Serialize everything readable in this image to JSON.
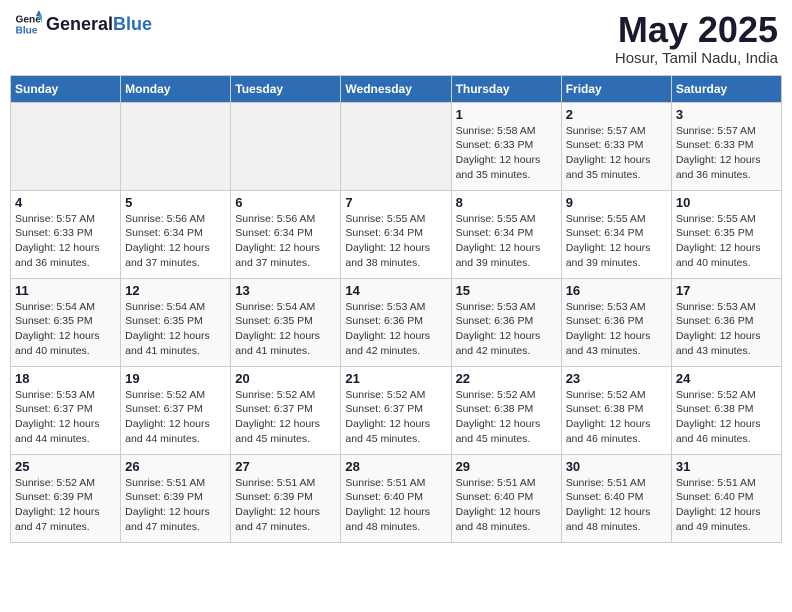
{
  "header": {
    "logo_general": "General",
    "logo_blue": "Blue",
    "title": "May 2025",
    "location": "Hosur, Tamil Nadu, India"
  },
  "days_of_week": [
    "Sunday",
    "Monday",
    "Tuesday",
    "Wednesday",
    "Thursday",
    "Friday",
    "Saturday"
  ],
  "weeks": [
    [
      {
        "day": "",
        "info": ""
      },
      {
        "day": "",
        "info": ""
      },
      {
        "day": "",
        "info": ""
      },
      {
        "day": "",
        "info": ""
      },
      {
        "day": "1",
        "info": "Sunrise: 5:58 AM\nSunset: 6:33 PM\nDaylight: 12 hours\nand 35 minutes."
      },
      {
        "day": "2",
        "info": "Sunrise: 5:57 AM\nSunset: 6:33 PM\nDaylight: 12 hours\nand 35 minutes."
      },
      {
        "day": "3",
        "info": "Sunrise: 5:57 AM\nSunset: 6:33 PM\nDaylight: 12 hours\nand 36 minutes."
      }
    ],
    [
      {
        "day": "4",
        "info": "Sunrise: 5:57 AM\nSunset: 6:33 PM\nDaylight: 12 hours\nand 36 minutes."
      },
      {
        "day": "5",
        "info": "Sunrise: 5:56 AM\nSunset: 6:34 PM\nDaylight: 12 hours\nand 37 minutes."
      },
      {
        "day": "6",
        "info": "Sunrise: 5:56 AM\nSunset: 6:34 PM\nDaylight: 12 hours\nand 37 minutes."
      },
      {
        "day": "7",
        "info": "Sunrise: 5:55 AM\nSunset: 6:34 PM\nDaylight: 12 hours\nand 38 minutes."
      },
      {
        "day": "8",
        "info": "Sunrise: 5:55 AM\nSunset: 6:34 PM\nDaylight: 12 hours\nand 39 minutes."
      },
      {
        "day": "9",
        "info": "Sunrise: 5:55 AM\nSunset: 6:34 PM\nDaylight: 12 hours\nand 39 minutes."
      },
      {
        "day": "10",
        "info": "Sunrise: 5:55 AM\nSunset: 6:35 PM\nDaylight: 12 hours\nand 40 minutes."
      }
    ],
    [
      {
        "day": "11",
        "info": "Sunrise: 5:54 AM\nSunset: 6:35 PM\nDaylight: 12 hours\nand 40 minutes."
      },
      {
        "day": "12",
        "info": "Sunrise: 5:54 AM\nSunset: 6:35 PM\nDaylight: 12 hours\nand 41 minutes."
      },
      {
        "day": "13",
        "info": "Sunrise: 5:54 AM\nSunset: 6:35 PM\nDaylight: 12 hours\nand 41 minutes."
      },
      {
        "day": "14",
        "info": "Sunrise: 5:53 AM\nSunset: 6:36 PM\nDaylight: 12 hours\nand 42 minutes."
      },
      {
        "day": "15",
        "info": "Sunrise: 5:53 AM\nSunset: 6:36 PM\nDaylight: 12 hours\nand 42 minutes."
      },
      {
        "day": "16",
        "info": "Sunrise: 5:53 AM\nSunset: 6:36 PM\nDaylight: 12 hours\nand 43 minutes."
      },
      {
        "day": "17",
        "info": "Sunrise: 5:53 AM\nSunset: 6:36 PM\nDaylight: 12 hours\nand 43 minutes."
      }
    ],
    [
      {
        "day": "18",
        "info": "Sunrise: 5:53 AM\nSunset: 6:37 PM\nDaylight: 12 hours\nand 44 minutes."
      },
      {
        "day": "19",
        "info": "Sunrise: 5:52 AM\nSunset: 6:37 PM\nDaylight: 12 hours\nand 44 minutes."
      },
      {
        "day": "20",
        "info": "Sunrise: 5:52 AM\nSunset: 6:37 PM\nDaylight: 12 hours\nand 45 minutes."
      },
      {
        "day": "21",
        "info": "Sunrise: 5:52 AM\nSunset: 6:37 PM\nDaylight: 12 hours\nand 45 minutes."
      },
      {
        "day": "22",
        "info": "Sunrise: 5:52 AM\nSunset: 6:38 PM\nDaylight: 12 hours\nand 45 minutes."
      },
      {
        "day": "23",
        "info": "Sunrise: 5:52 AM\nSunset: 6:38 PM\nDaylight: 12 hours\nand 46 minutes."
      },
      {
        "day": "24",
        "info": "Sunrise: 5:52 AM\nSunset: 6:38 PM\nDaylight: 12 hours\nand 46 minutes."
      }
    ],
    [
      {
        "day": "25",
        "info": "Sunrise: 5:52 AM\nSunset: 6:39 PM\nDaylight: 12 hours\nand 47 minutes."
      },
      {
        "day": "26",
        "info": "Sunrise: 5:51 AM\nSunset: 6:39 PM\nDaylight: 12 hours\nand 47 minutes."
      },
      {
        "day": "27",
        "info": "Sunrise: 5:51 AM\nSunset: 6:39 PM\nDaylight: 12 hours\nand 47 minutes."
      },
      {
        "day": "28",
        "info": "Sunrise: 5:51 AM\nSunset: 6:40 PM\nDaylight: 12 hours\nand 48 minutes."
      },
      {
        "day": "29",
        "info": "Sunrise: 5:51 AM\nSunset: 6:40 PM\nDaylight: 12 hours\nand 48 minutes."
      },
      {
        "day": "30",
        "info": "Sunrise: 5:51 AM\nSunset: 6:40 PM\nDaylight: 12 hours\nand 48 minutes."
      },
      {
        "day": "31",
        "info": "Sunrise: 5:51 AM\nSunset: 6:40 PM\nDaylight: 12 hours\nand 49 minutes."
      }
    ]
  ]
}
